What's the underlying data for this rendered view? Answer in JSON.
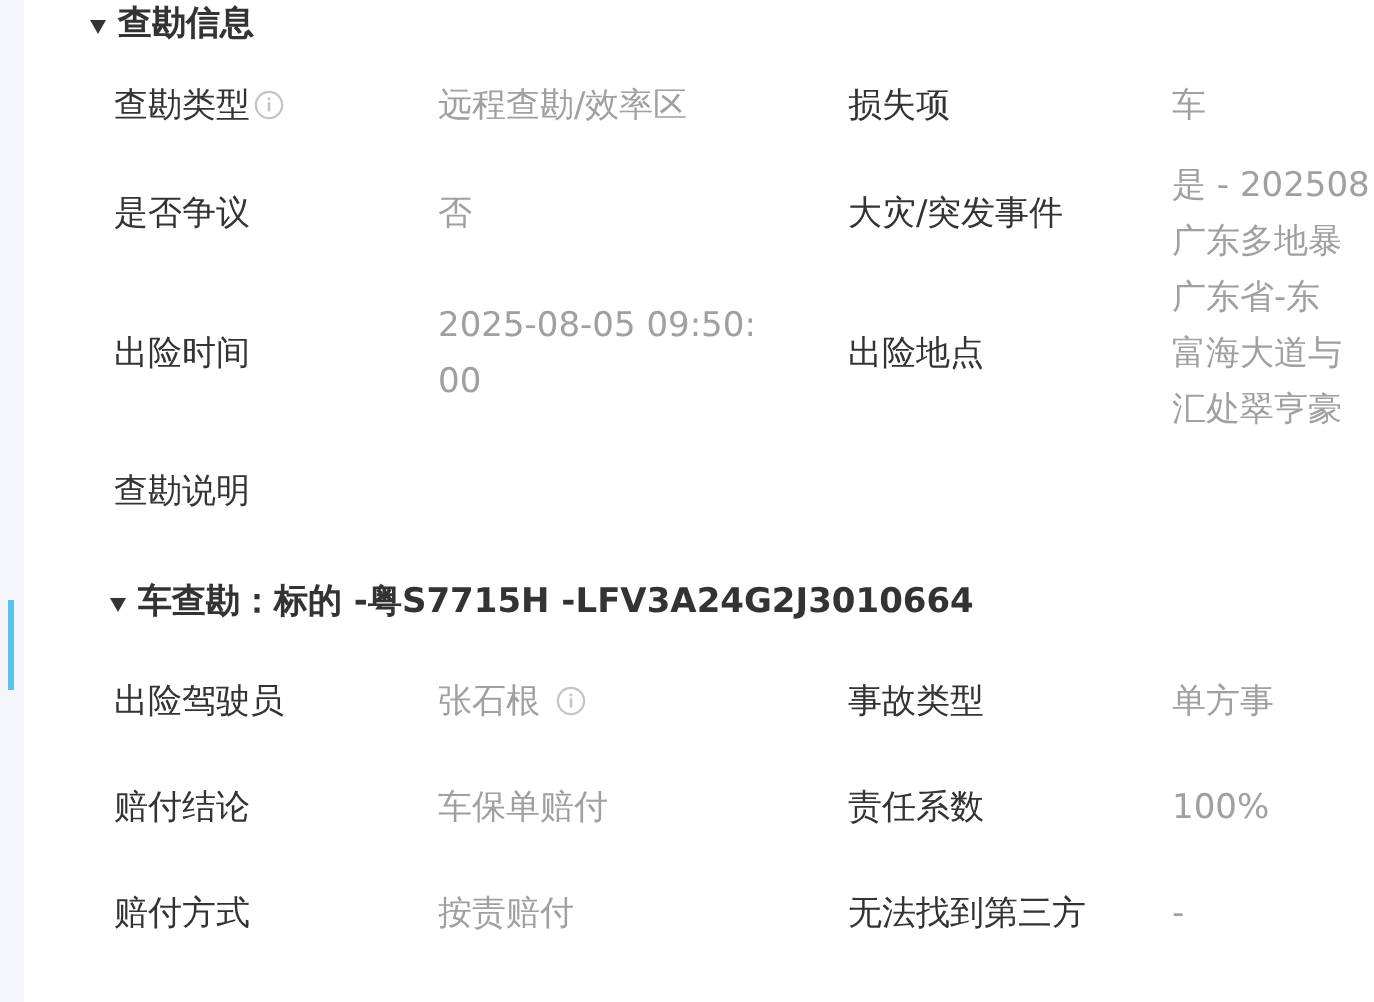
{
  "sections": [
    {
      "title": "查勘信息",
      "expanded": true,
      "rows": [
        [
          {
            "label": "查勘类型",
            "info_icon": true,
            "lines": [
              "远程查勘/效率区"
            ]
          },
          {
            "label": "损失项",
            "lines": [
              "车"
            ]
          }
        ],
        [
          {
            "label": "是否争议",
            "lines": [
              "否"
            ]
          },
          {
            "label": "大灾/突发事件",
            "lines": [
              "是 - 202508",
              "广东多地暴"
            ]
          }
        ],
        [
          {
            "label": "出险时间",
            "lines": [
              "2025-08-05 09:50:",
              "00"
            ]
          },
          {
            "label": "出险地点",
            "lines": [
              "广东省-东",
              "富海大道与",
              "汇处翠亨豪"
            ]
          }
        ],
        [
          {
            "label": "查勘说明"
          }
        ]
      ]
    },
    {
      "title": "车查勘：标的 -粤S7715H -LFV3A24G2J3010664",
      "expanded": true,
      "rows": [
        [
          {
            "label": "出险驾驶员",
            "info_icon": true,
            "lines": [
              "张石根"
            ]
          },
          {
            "label": "事故类型",
            "lines": [
              "单方事"
            ]
          }
        ],
        [
          {
            "label": "赔付结论",
            "lines": [
              "车保单赔付"
            ]
          },
          {
            "label": "责任系数",
            "lines": [
              "100%"
            ]
          }
        ],
        [
          {
            "label": "赔付方式",
            "lines": [
              "按责赔付"
            ]
          },
          {
            "label": "无法找到第三方",
            "lines": [
              "-"
            ]
          }
        ]
      ]
    }
  ]
}
